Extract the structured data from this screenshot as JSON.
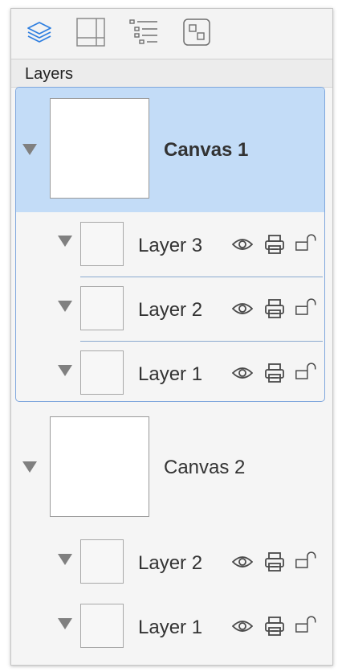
{
  "toolbar": {
    "tools": [
      {
        "icon": "layers-icon",
        "active": true
      },
      {
        "icon": "canvas-size-icon",
        "active": false
      },
      {
        "icon": "outline-icon",
        "active": false
      },
      {
        "icon": "object-icon",
        "active": false
      }
    ]
  },
  "section": {
    "title": "Layers"
  },
  "canvases": [
    {
      "name": "Canvas 1",
      "selected": true,
      "layers": [
        {
          "name": "Layer 3"
        },
        {
          "name": "Layer 2"
        },
        {
          "name": "Layer 1"
        }
      ]
    },
    {
      "name": "Canvas 2",
      "selected": false,
      "layers": [
        {
          "name": "Layer 2"
        },
        {
          "name": "Layer 1"
        }
      ]
    }
  ],
  "colors": {
    "accent": "#2f7fe0",
    "selection": "#c3dcf7",
    "selection_border": "#7fa7dd"
  }
}
